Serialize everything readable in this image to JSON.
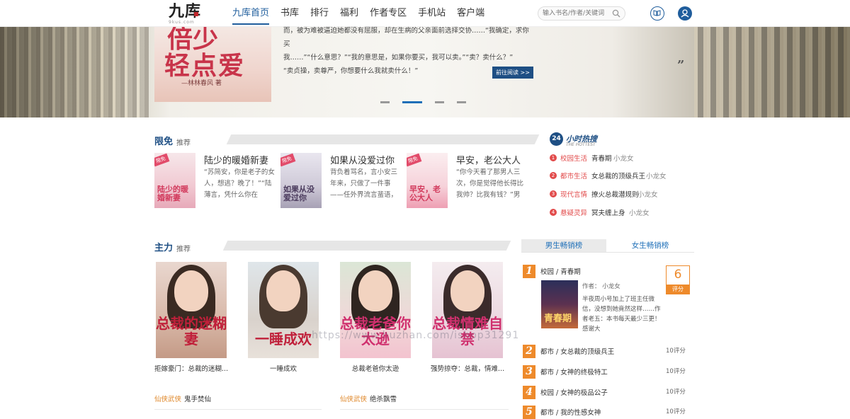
{
  "header": {
    "logo_main": "九库",
    "logo_sub": "9kus.com",
    "nav": [
      "九库首页",
      "书库",
      "排行",
      "福利",
      "作者专区",
      "手机站",
      "客户端"
    ],
    "search_placeholder": "输入书名/作者/关键词"
  },
  "banner": {
    "cover_title_line1": "倍少",
    "cover_title_line2": "轻点爱",
    "cover_author": "—林林春风 著",
    "text_lines": [
      "而，被为难被逼迫她都没有屈服，却在生病的父亲面前选择交协……“我确定，求你买",
      "我……”“什么意思？”“我的意思是，如果你要买，我可以卖。”“卖？卖什么？”",
      "“卖贞操，卖尊严，你想要什么我就卖什么！”"
    ],
    "read_button": "前往阅读 >>",
    "quote_mark": "”"
  },
  "free_section": {
    "title": "限免",
    "subtitle": "推荐",
    "books": [
      {
        "title": "陆少的暖婚新妻",
        "tag": "限免",
        "cover_text": "陆少的暖婚新妻",
        "desc": "“苏简安，你是老子的女人，想逃？晚了！”“陆薄言，凭什么你在"
      },
      {
        "title": "如果从没爱过你",
        "tag": "限免",
        "cover_text": "如果从没爱过你",
        "desc": "背负着骂名，言小安三年来，只做了一件事——任外界流言蜚语，"
      },
      {
        "title": "早安，老公大人",
        "tag": "限免",
        "cover_text": "早安，老公大人",
        "desc": "“你今天看了那男人三次，你是觉得他长得比我帅？比我有钱？”男"
      }
    ]
  },
  "hot24": {
    "badge": "24",
    "title": "小时热搜",
    "subtitle": "THE HOTTEST",
    "items": [
      {
        "num": "1",
        "cat": "校园生活",
        "book": "青春期",
        "author": "小龙女"
      },
      {
        "num": "2",
        "cat": "都市生活",
        "book": "女总裁的顶级兵王",
        "author": "小龙女"
      },
      {
        "num": "3",
        "cat": "现代言情",
        "book": "撩火总裁潜规则",
        "author": "小龙女"
      },
      {
        "num": "4",
        "cat": "悬疑灵异",
        "book": "冥夫缠上身",
        "author": "小龙女"
      }
    ]
  },
  "main_section": {
    "title": "主力",
    "subtitle": "推荐",
    "books": [
      {
        "title": "拒嫁豪门：总裁的迷糊...",
        "cover_text": "总裁的迷糊妻",
        "cover_color": "#c0203a"
      },
      {
        "title": "一睡成欢",
        "cover_text": "一睡成欢",
        "cover_color": "#c0203a"
      },
      {
        "title": "总裁老爸你太逊",
        "cover_text": "总裁老爸你太逊",
        "cover_color": "#d0306e"
      },
      {
        "title": "强势掠夺：总裁，情难...",
        "cover_text": "总裁情难自禁",
        "cover_color": "#d0306e"
      }
    ],
    "cats": [
      {
        "cat": "仙侠武侠",
        "book": "鬼手焚仙"
      },
      {
        "cat": "仙侠武侠",
        "book": "绝杀飘雪"
      }
    ]
  },
  "rank": {
    "tab_male": "男生畅销榜",
    "tab_female": "女生畅销榜",
    "first": {
      "num": "1",
      "line": "校园 / 青春期",
      "author": "作者：  小龙女",
      "desc": "半夜周小号加上了班主任微信，没想到她竟然这样……作者老五：本书每天最少三更！感谢大",
      "cover_text": "青春期",
      "score": "6",
      "score_label": "评分"
    },
    "items": [
      {
        "num": "2",
        "line": "都市 / 女总裁的顶级兵王",
        "score": "10评分"
      },
      {
        "num": "3",
        "line": "都市 / 女神的终极特工",
        "score": "10评分"
      },
      {
        "num": "4",
        "line": "校园 / 女神的极品公子",
        "score": "10评分"
      },
      {
        "num": "5",
        "line": "都市 / 我的性感女神",
        "score": "10评分"
      }
    ]
  },
  "watermark": "https://www.huzhan.com/ishop31291",
  "colors": {
    "accent": "#1e4f84",
    "orange": "#ee8a2b",
    "red": "#e24b4b"
  }
}
